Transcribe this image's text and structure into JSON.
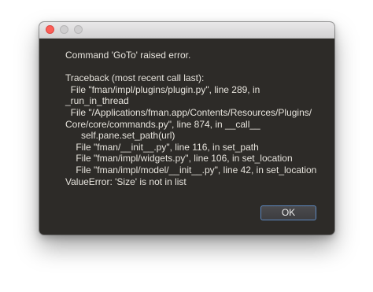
{
  "dialog": {
    "message": "Command 'GoTo' raised error.",
    "traceback_lines": [
      "Traceback (most recent call last):",
      "  File \"fman/impl/plugins/plugin.py\", line 289, in",
      "_run_in_thread",
      "  File \"/Applications/fman.app/Contents/Resources/Plugins/",
      "Core/core/commands.py\", line 874, in __call__",
      "      self.pane.set_path(url)",
      "    File \"fman/__init__.py\", line 116, in set_path",
      "    File \"fman/impl/widgets.py\", line 106, in set_location",
      "    File \"fman/impl/model/__init__.py\", line 42, in set_location",
      "ValueError: 'Size' is not in list"
    ],
    "ok_label": "OK"
  },
  "colors": {
    "background": "#2d2b28",
    "text": "#e6e3dc",
    "close_button": "#fc5e57",
    "button_border": "#5e88bf"
  },
  "icons": {
    "close": "close-dot-icon",
    "minimize": "minimize-dot-icon",
    "zoom": "zoom-dot-icon"
  }
}
